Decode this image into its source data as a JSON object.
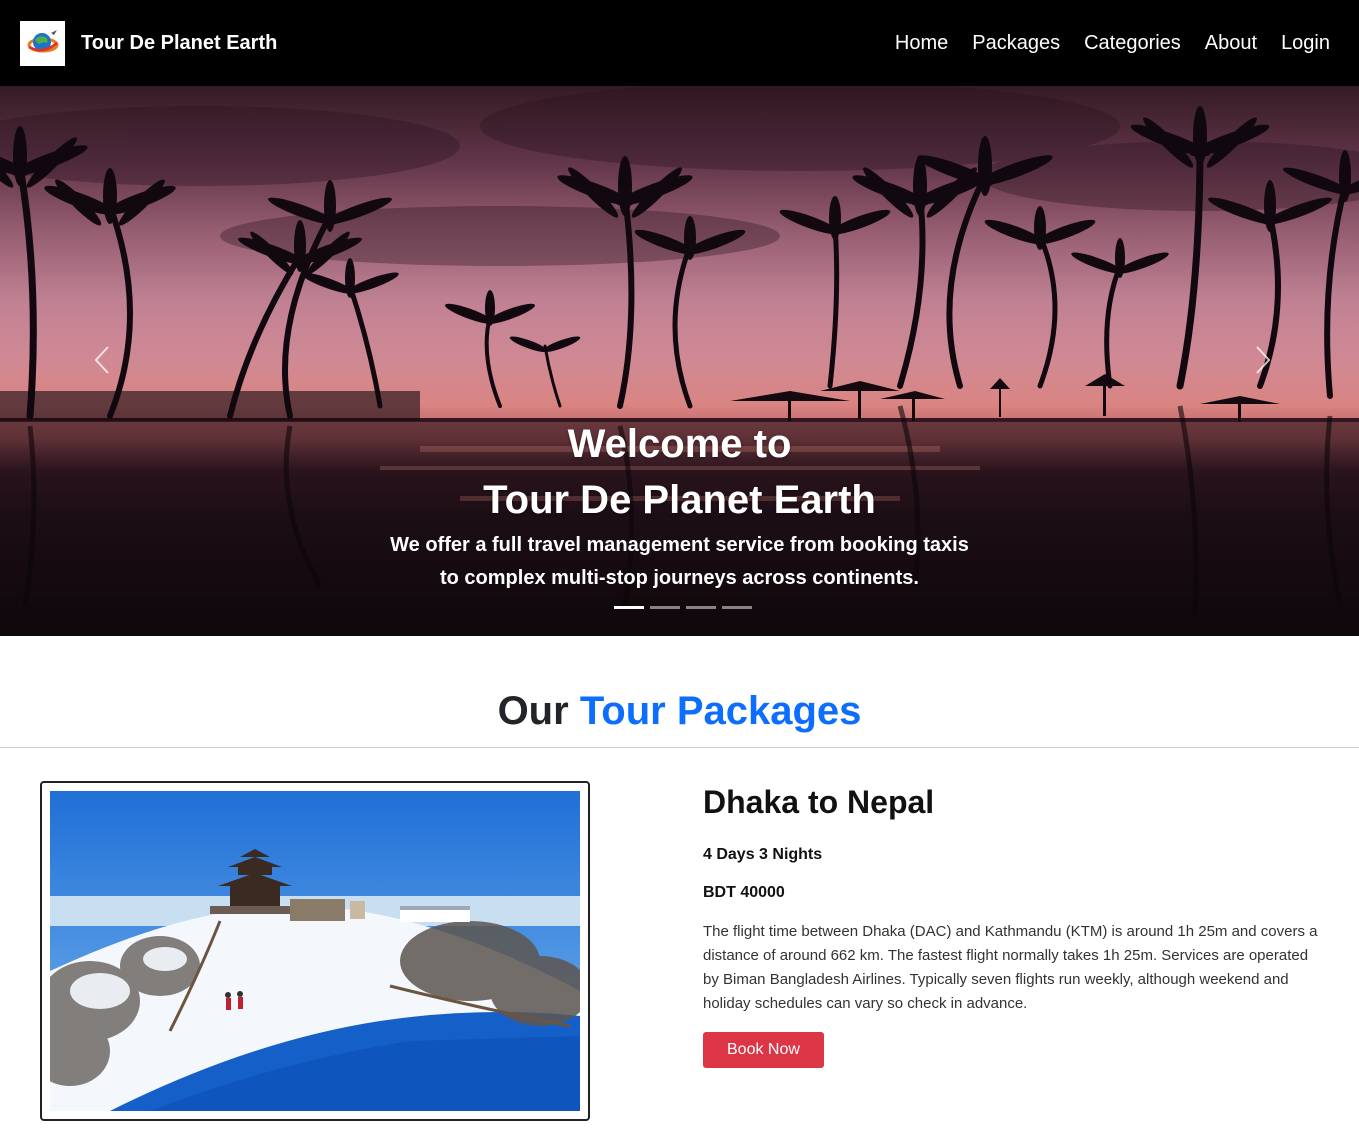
{
  "navbar": {
    "brand_name": "Tour De Planet Earth",
    "links": [
      "Home",
      "Packages",
      "Categories",
      "About",
      "Login"
    ]
  },
  "hero": {
    "title_line1": "Welcome to",
    "title_line2": "Tour De Planet Earth",
    "subtitle_line1": "We offer a full travel management service from booking taxis",
    "subtitle_line2": "to complex multi-stop journeys across continents.",
    "slide_count": 4,
    "active_slide": 1
  },
  "packages_section": {
    "title_plain": "Our",
    "title_accent": "Tour Packages",
    "accent_color": "#0d6efd"
  },
  "package": {
    "name": "Dhaka to Nepal",
    "duration": "4 Days 3 Nights",
    "price": "BDT 40000",
    "description": "The flight time between Dhaka (DAC) and Kathmandu (KTM) is around 1h 25m and covers a distance of around 662 km. The fastest flight normally takes 1h 25m. Services are operated by Biman Bangladesh Airlines. Typically seven flights run weekly, although weekend and holiday schedules can vary so check in advance.",
    "button_label": "Book Now",
    "button_color": "#dc3545"
  }
}
